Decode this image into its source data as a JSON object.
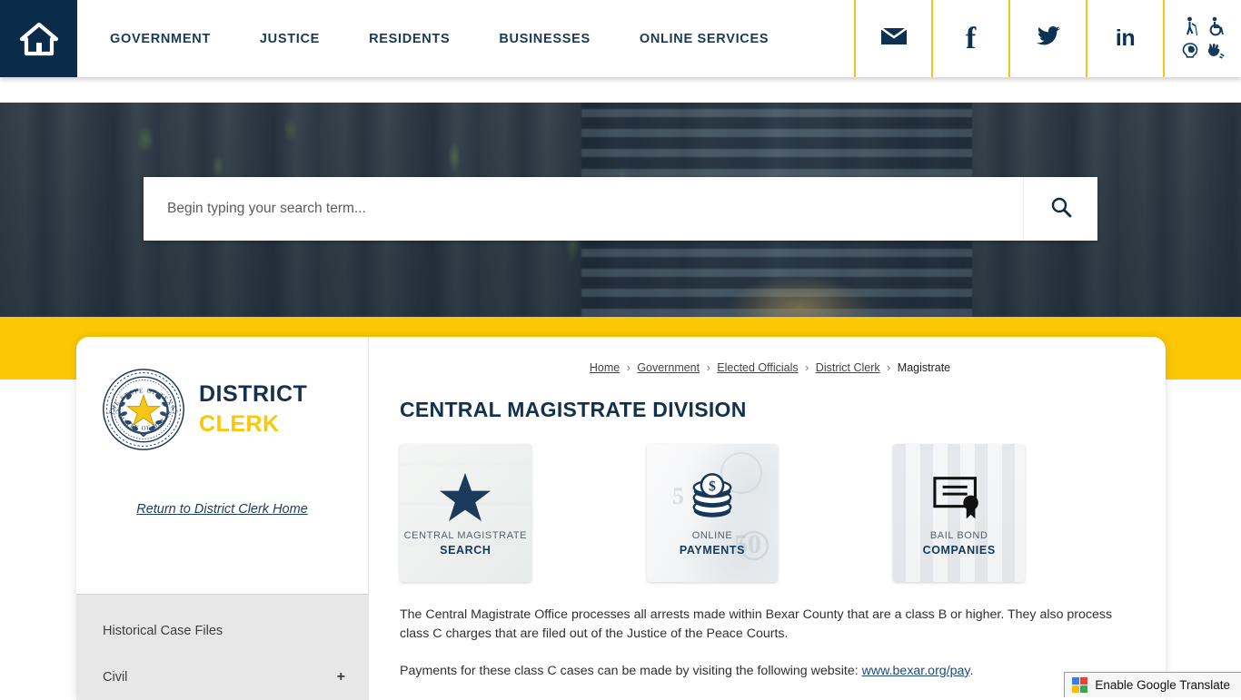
{
  "colors": {
    "navy": "#0a2c4a",
    "navy_text": "#1b3a55",
    "yellow": "#fbc707",
    "sidebar_gray": "#e7e7e7",
    "link": "#1c4a7a"
  },
  "header": {
    "home_icon": "home-icon",
    "nav": [
      {
        "label": "GOVERNMENT"
      },
      {
        "label": "JUSTICE"
      },
      {
        "label": "RESIDENTS"
      },
      {
        "label": "BUSINESSES"
      },
      {
        "label": "ONLINE SERVICES"
      }
    ],
    "social": [
      {
        "name": "email-icon",
        "glyph": "✉"
      },
      {
        "name": "facebook-icon",
        "glyph": "f"
      },
      {
        "name": "twitter-icon",
        "glyph": "twitter"
      },
      {
        "name": "linkedin-icon",
        "glyph": "in"
      }
    ],
    "accessibility": [
      {
        "name": "blind-person-icon"
      },
      {
        "name": "wheelchair-icon"
      },
      {
        "name": "cognitive-head-icon"
      },
      {
        "name": "sign-language-icon"
      }
    ]
  },
  "hero": {
    "search": {
      "placeholder": "Begin typing your search term...",
      "value": "",
      "button_icon": "search-icon"
    }
  },
  "sidebar": {
    "seal": {
      "top_text": "THE STATE OF TEXAS",
      "bottom_text": "COUNTY OF BEXAR",
      "icon": "texas-state-seal"
    },
    "brand": {
      "line1": "DISTRICT",
      "line2": "CLERK"
    },
    "return_link": "Return to District Clerk Home",
    "items": [
      {
        "label": "Historical Case Files",
        "expander": ""
      },
      {
        "label": "Civil",
        "expander": "+"
      }
    ]
  },
  "main": {
    "breadcrumb": [
      {
        "label": "Home",
        "link": true
      },
      {
        "label": "Government",
        "link": true
      },
      {
        "label": "Elected Officials",
        "link": true
      },
      {
        "label": "District Clerk",
        "link": true
      },
      {
        "label": "Magistrate",
        "link": false
      }
    ],
    "breadcrumb_separator": "›",
    "page_title": "CENTRAL MAGISTRATE DIVISION",
    "tiles": [
      {
        "icon": "star-icon",
        "label_top": "CENTRAL MAGISTRATE",
        "label_bottom": "SEARCH"
      },
      {
        "icon": "coins-dollar-icon",
        "label_top": "ONLINE",
        "label_bottom": "PAYMENTS"
      },
      {
        "icon": "certificate-seal-icon",
        "label_top": "BAIL BOND",
        "label_bottom": "COMPANIES"
      }
    ],
    "paragraph_1": "The Central Magistrate Office processes all arrests made within Bexar County that are a class B or higher. They also process class C charges that are filed out of the Justice of the Peace Courts.",
    "paragraph_2_before": "Payments for these class C cases can be made by visiting the following website: ",
    "paragraph_2_link": "www.bexar.org/pay",
    "paragraph_2_after": "."
  },
  "translate_widget": {
    "label": "Enable Google Translate",
    "icon": "google-translate-icon"
  }
}
